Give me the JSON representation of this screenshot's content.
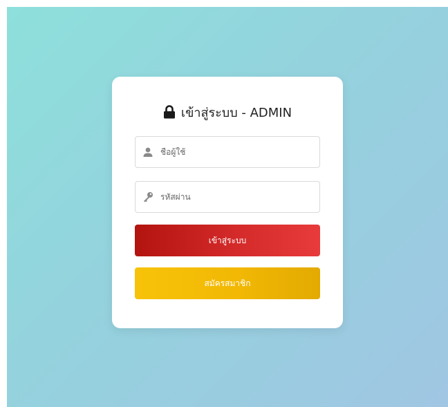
{
  "login": {
    "title": "เข้าสู่ระบบ - ADMIN",
    "username_placeholder": "ชื่อผู้ใช้",
    "password_placeholder": "รหัสผ่าน",
    "login_button": "เข้าสู่ระบบ",
    "register_button": "สมัครสมาชิก"
  },
  "icons": {
    "title": "lock-icon",
    "username": "user-icon",
    "password": "key-icon"
  },
  "colors": {
    "background_start": "#8ee0dc",
    "background_end": "#a0c6e3",
    "card": "#ffffff",
    "login_button": "#d42a2a",
    "register_button": "#f2b804"
  }
}
